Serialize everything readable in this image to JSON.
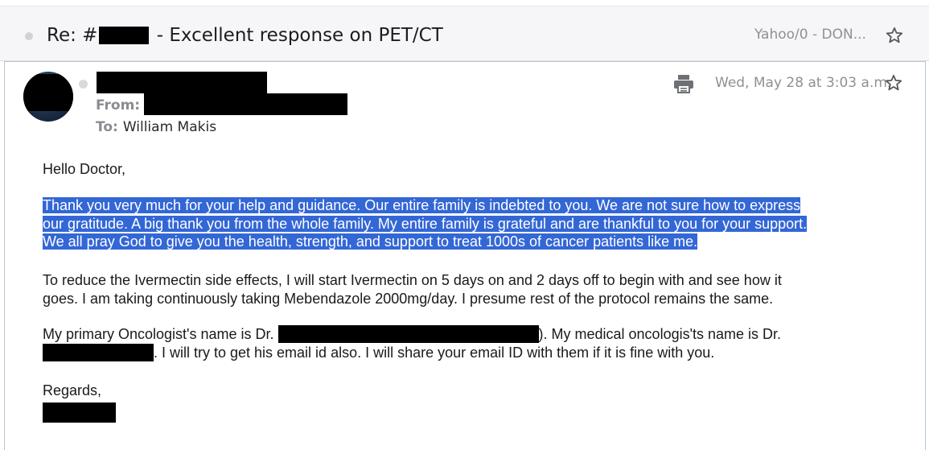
{
  "thread": {
    "subject_prefix": "Re: #",
    "subject_suffix": " - Excellent response on PET/CT",
    "folder": "Yahoo/0 - DON..."
  },
  "message": {
    "from_label": "From:",
    "to_label": "To:",
    "to_name": "William Makis",
    "date": "Wed, May 28 at 3:03 a.m."
  },
  "body": {
    "greeting": "Hello Doctor,",
    "para1_lines": [
      "Thank you very much for your help and guidance. Our entire family is indebted to you. We are not sure how to express",
      "our gratitude. A big thank you from the whole family. My entire family is grateful and are thankful to you for your support.",
      "We all pray God to give you the health, strength, and support to treat 1000s of cancer patients like me."
    ],
    "para2_lines": [
      "To reduce the Ivermectin side effects, I will start Ivermectin on 5 days on and 2 days off to begin with and see how it",
      "goes. I am taking continuously taking Mebendazole 2000mg/day. I presume rest of the protocol remains the same."
    ],
    "para3": {
      "line1_start": "My primary Oncologist's name is Dr. ",
      "line1_end": "). My medical oncologis'ts name is Dr.",
      "line2_end": ". I will try to get his email id also. I will share your email ID with them if it is fine with you."
    },
    "closing": "Regards,"
  },
  "colors": {
    "selection_highlight": "#3367d6",
    "thread_bar_bg": "#f6f6f8",
    "meta_gray": "#8f9095"
  },
  "icons": {
    "thread_star": "star-outline-icon",
    "message_star": "star-outline-icon",
    "print": "printer-icon"
  }
}
